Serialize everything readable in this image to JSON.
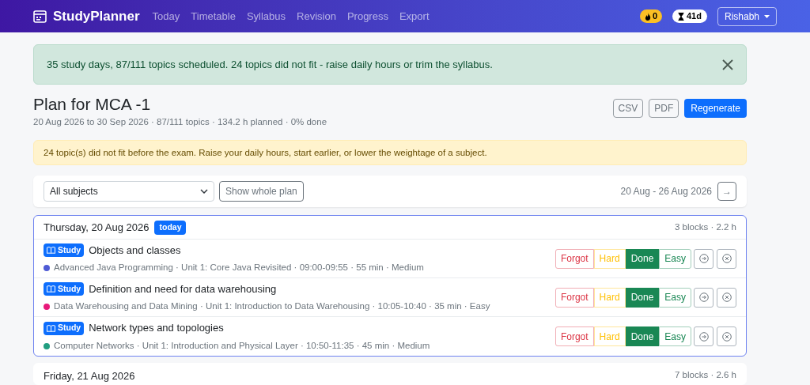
{
  "navbar": {
    "brand": "StudyPlanner",
    "links": [
      {
        "label": "Today",
        "selected": false
      },
      {
        "label": "Timetable",
        "selected": false
      },
      {
        "label": "Syllabus",
        "selected": false
      },
      {
        "label": "Revision",
        "selected": false
      },
      {
        "label": "Progress",
        "selected": false
      },
      {
        "label": "Export",
        "selected": false
      }
    ],
    "streak_badge": "0",
    "countdown_badge": "41d",
    "user_menu": "Rishabh"
  },
  "success_alert": {
    "text": "35 study days, 87/111 topics scheduled. 24 topics did not fit - raise daily hours or trim the syllabus."
  },
  "plan": {
    "title": "Plan for MCA -1",
    "summary": "20 Aug 2026 to 30 Sep 2026 · 87/111 topics · 134.2 h planned · 0% done",
    "buttons": [
      {
        "label": "CSV",
        "kind": "outline"
      },
      {
        "label": "PDF",
        "kind": "outline"
      },
      {
        "label": "Regenerate",
        "kind": "primary"
      }
    ]
  },
  "warning_alert": {
    "text": "24 topic(s) did not fit before the exam. Raise your daily hours, start earlier, or lower the weightage of a subject."
  },
  "filter": {
    "subject_select": "All subjects",
    "toggle_button": "Show whole plan",
    "range": "20 Aug - 26 Aug 2026",
    "next_button": "→"
  },
  "days": [
    {
      "date": "Thursday, 20 Aug 2026",
      "today": true,
      "today_badge": "today",
      "stats": "3 blocks · 2.2 h",
      "blocks": [
        {
          "tag": "Study",
          "title": "Objects and classes",
          "color": "#4f5bd5",
          "meta": "Advanced Java Programming · Unit 1: Core Java Revisited · 09:00-09:55 · 55 min · Medium",
          "ratings": [
            {
              "label": "Forgot",
              "kind": "forgot",
              "selected": false
            },
            {
              "label": "Hard",
              "kind": "hard",
              "selected": false
            },
            {
              "label": "Done",
              "kind": "done",
              "selected": true
            },
            {
              "label": "Easy",
              "kind": "easy",
              "selected": false
            }
          ]
        },
        {
          "tag": "Study",
          "title": "Definition and need for data warehousing",
          "color": "#e8197a",
          "meta": "Data Warehousing and Data Mining · Unit 1: Introduction to Data Warehousing · 10:05-10:40 · 35 min · Easy",
          "ratings": [
            {
              "label": "Forgot",
              "kind": "forgot",
              "selected": false
            },
            {
              "label": "Hard",
              "kind": "hard",
              "selected": false
            },
            {
              "label": "Done",
              "kind": "done",
              "selected": true
            },
            {
              "label": "Easy",
              "kind": "easy",
              "selected": false
            }
          ]
        },
        {
          "tag": "Study",
          "title": "Network types and topologies",
          "color": "#229e80",
          "meta": "Computer Networks · Unit 1: Introduction and Physical Layer · 10:50-11:35 · 45 min · Medium",
          "ratings": [
            {
              "label": "Forgot",
              "kind": "forgot",
              "selected": false
            },
            {
              "label": "Hard",
              "kind": "hard",
              "selected": false
            },
            {
              "label": "Done",
              "kind": "done",
              "selected": true
            },
            {
              "label": "Easy",
              "kind": "easy",
              "selected": false
            }
          ]
        }
      ]
    },
    {
      "date": "Friday, 21 Aug 2026",
      "today": false,
      "stats": "7 blocks · 2.6 h"
    }
  ]
}
